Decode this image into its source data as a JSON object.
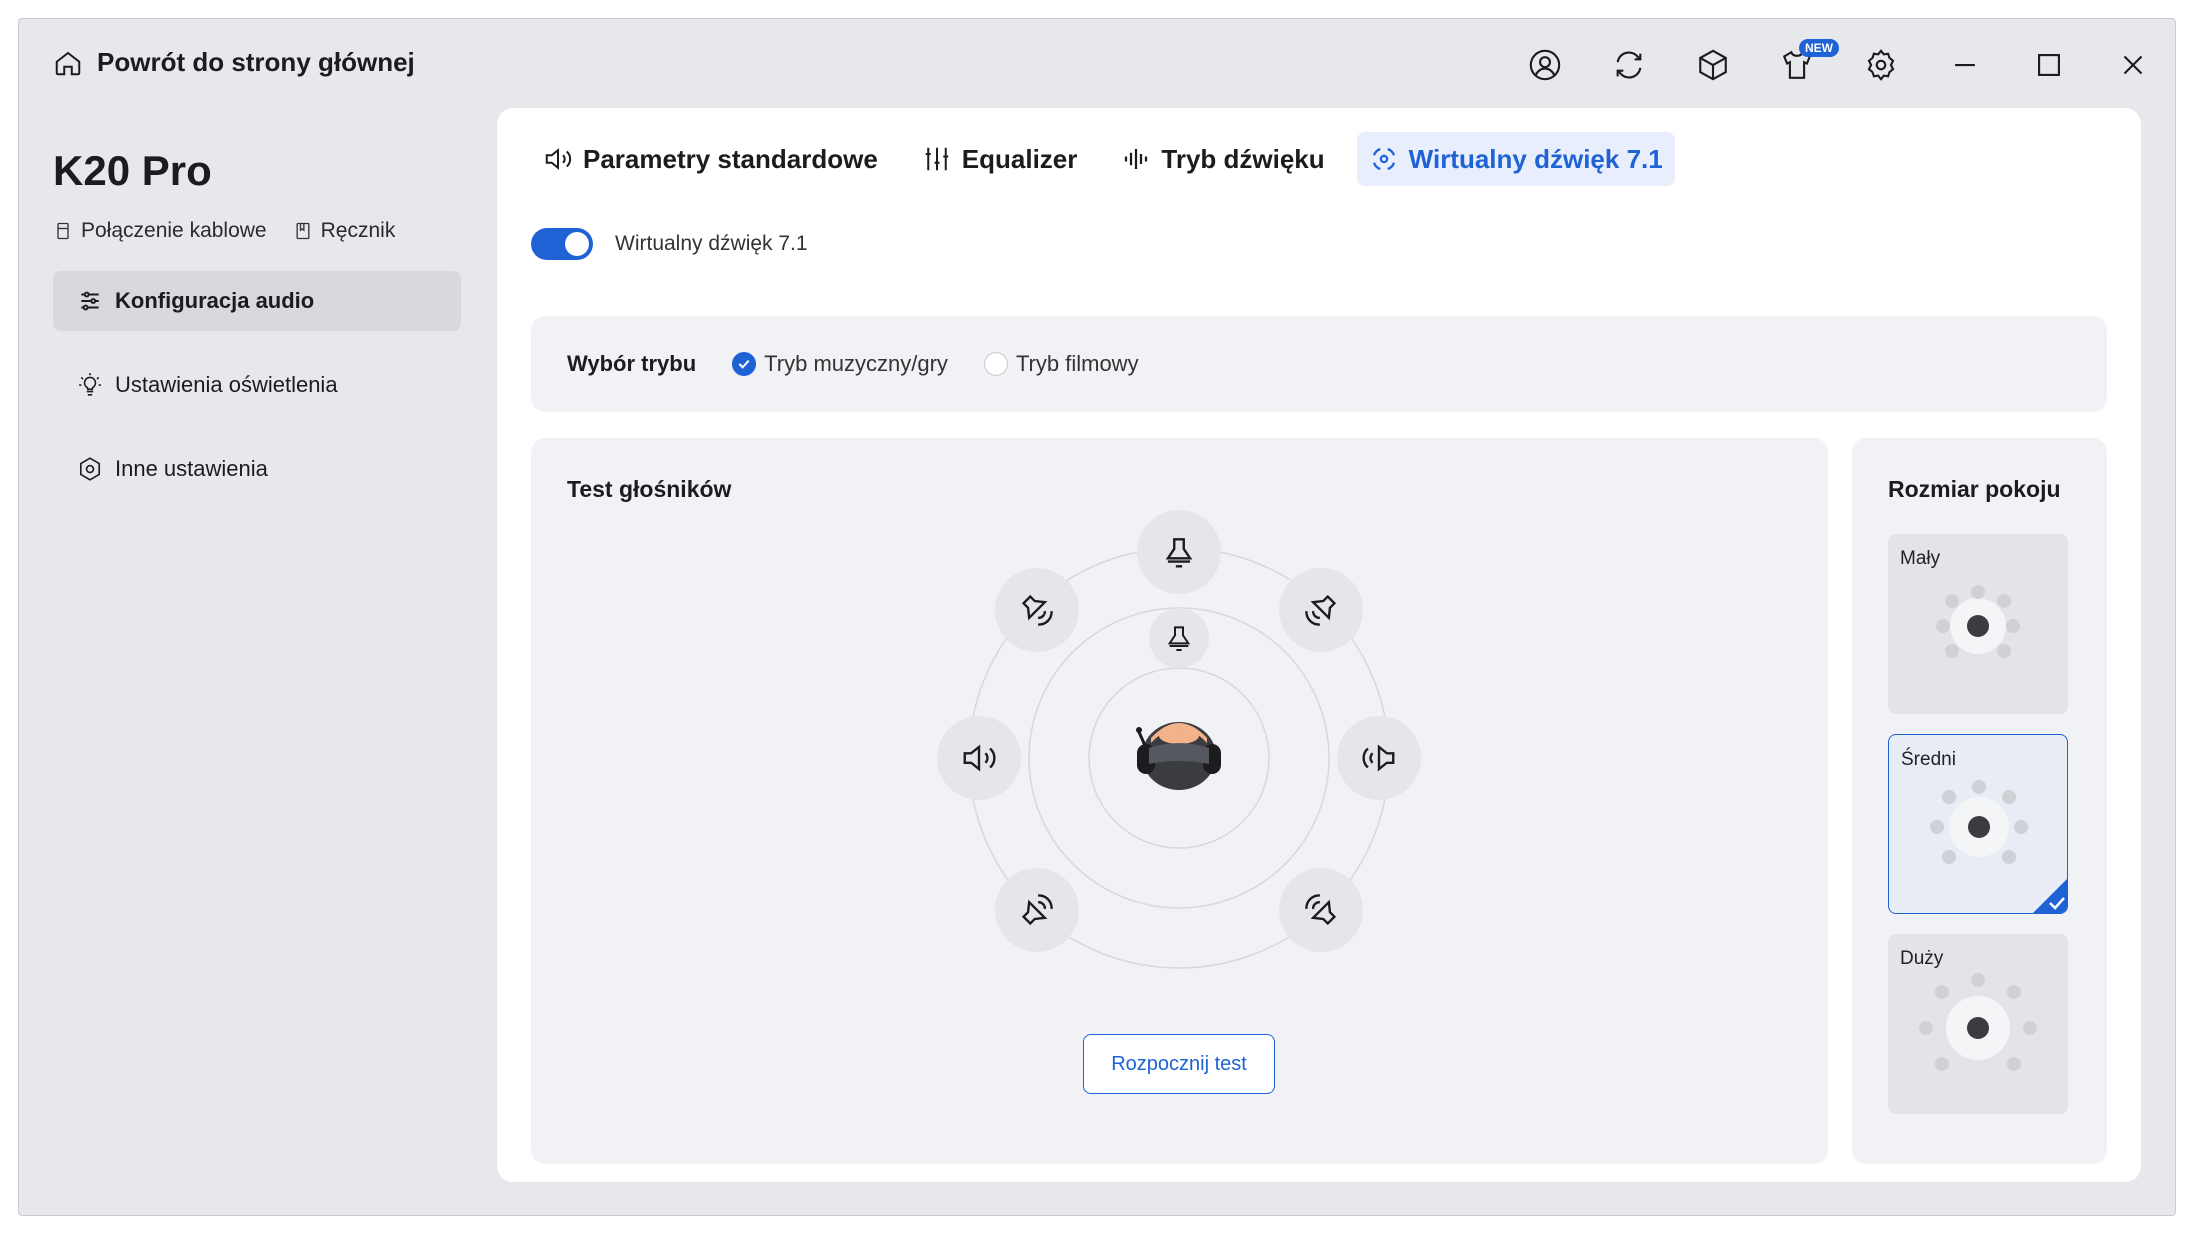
{
  "titlebar": {
    "back_label": "Powrót do strony głównej",
    "new_badge": "NEW",
    "icons": [
      "account-icon",
      "refresh-icon",
      "package-icon",
      "tshirt-icon",
      "gear-icon",
      "minimize-icon",
      "maximize-icon",
      "close-icon"
    ]
  },
  "device": {
    "name": "K20 Pro",
    "connection": "Połączenie kablowe",
    "manual": "Ręcznik"
  },
  "sidebar": {
    "items": [
      {
        "label": "Konfiguracja audio",
        "active": true
      },
      {
        "label": "Ustawienia oświetlenia",
        "active": false
      },
      {
        "label": "Inne ustawienia",
        "active": false
      }
    ]
  },
  "tabs": [
    {
      "label": "Parametry standardowe",
      "active": false
    },
    {
      "label": "Equalizer",
      "active": false
    },
    {
      "label": "Tryb dźwięku",
      "active": false
    },
    {
      "label": "Wirtualny dźwięk 7.1",
      "active": true
    }
  ],
  "virtual_toggle": {
    "label": "Wirtualny dźwięk 7.1",
    "on": true
  },
  "mode": {
    "label": "Wybór trybu",
    "options": [
      {
        "label": "Tryb muzyczny/gry",
        "checked": true
      },
      {
        "label": "Tryb filmowy",
        "checked": false
      }
    ]
  },
  "speaker_test": {
    "title": "Test głośników",
    "start_button": "Rozpocznij test"
  },
  "room_size": {
    "title": "Rozmiar pokoju",
    "options": [
      {
        "label": "Mały",
        "selected": false
      },
      {
        "label": "Średni",
        "selected": true
      },
      {
        "label": "Duży",
        "selected": false
      }
    ]
  },
  "colors": {
    "accent": "#1e62d6",
    "window_bg": "#e7e8ec",
    "panel_bg": "#ffffff",
    "card_bg": "#f1f2f5"
  }
}
